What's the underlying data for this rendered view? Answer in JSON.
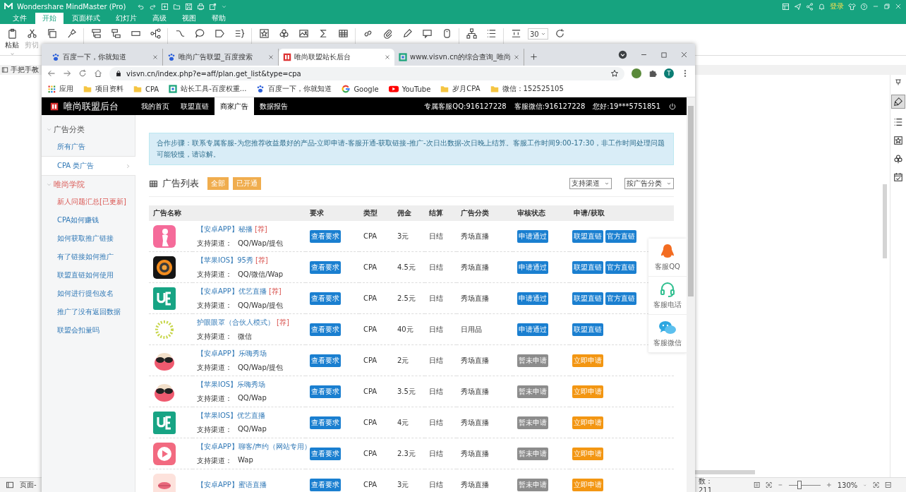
{
  "app": {
    "title": "Wondershare MindMaster (Pro)",
    "menu": [
      {
        "label": "文件",
        "selected": false
      },
      {
        "label": "开始",
        "selected": true
      },
      {
        "label": "页面样式",
        "selected": false
      },
      {
        "label": "幻灯片",
        "selected": false
      },
      {
        "label": "高级",
        "selected": false
      },
      {
        "label": "视图",
        "selected": false
      },
      {
        "label": "帮助",
        "selected": false
      }
    ],
    "login": "登录",
    "ribbon_labels": [
      {
        "label": "粘贴",
        "disabled": false
      },
      {
        "label": "剪切",
        "disabled": true
      }
    ],
    "font_size": "30",
    "document_tab": "手把手教",
    "status": {
      "page": "页面-",
      "count": "数：211",
      "zoom": "130%",
      "zoom_slider": {
        "level": 0.33
      }
    }
  },
  "browser": {
    "tabs": [
      {
        "title": "百度一下，你就知道",
        "kind": "paw",
        "selected": false
      },
      {
        "title": "唯尚广告联盟_百度搜索",
        "kind": "paw",
        "selected": false
      },
      {
        "title": "唯尚联盟站长后台",
        "kind": "logo",
        "selected": true
      },
      {
        "title": "www.visvn.cn的综合查询_唯尚",
        "kind": "square",
        "selected": false
      }
    ],
    "url": "visvn.cn/index.php?e=aff/plan.get_list&type=cpa",
    "profile": "T",
    "bookmarks": [
      {
        "label": "应用",
        "kind": "grid"
      },
      {
        "label": "项目资料",
        "kind": "folder"
      },
      {
        "label": "CPA",
        "kind": "folder"
      },
      {
        "label": "站长工具-百度权重...",
        "kind": "tool"
      },
      {
        "label": "百度一下，你就知道",
        "kind": "paw"
      },
      {
        "label": "Google",
        "kind": "google"
      },
      {
        "label": "YouTube",
        "kind": "youtube"
      },
      {
        "label": "岁月CPA",
        "kind": "folder"
      },
      {
        "label": "微信：152525105",
        "kind": "folder"
      }
    ]
  },
  "site": {
    "brand": "唯尚联盟后台",
    "nav": [
      {
        "label": "我的首页",
        "selected": false
      },
      {
        "label": "联盟直链",
        "selected": false
      },
      {
        "label": "商家广告",
        "selected": true
      },
      {
        "label": "数据报告",
        "selected": false
      }
    ],
    "contacts": [
      "专属客服QQ:916127228",
      "客服微信:916127228",
      "您好:19***5751851"
    ],
    "sidebar": [
      {
        "title": "广告分类",
        "highlighted": false,
        "expanded": true,
        "items": [
          {
            "label": "所有广告",
            "selected": false,
            "highlighted": false
          },
          {
            "label": "CPA 类广告",
            "selected": true,
            "highlighted": false
          }
        ]
      },
      {
        "title": "唯尚学院",
        "highlighted": true,
        "expanded": true,
        "items": [
          {
            "label": "新人问题汇总[已更新]",
            "selected": false,
            "highlighted": true
          },
          {
            "label": "CPA如何赚钱",
            "selected": false,
            "highlighted": false
          },
          {
            "label": "如何获取推广链接",
            "selected": false,
            "highlighted": false
          },
          {
            "label": "有了链接如何推广",
            "selected": false,
            "highlighted": false
          },
          {
            "label": "联盟直链如何使用",
            "selected": false,
            "highlighted": false
          },
          {
            "label": "如何进行提包改名",
            "selected": false,
            "highlighted": false
          },
          {
            "label": "推广了没有返回数据",
            "selected": false,
            "highlighted": false
          },
          {
            "label": "联盟会扣量吗",
            "selected": false,
            "highlighted": false
          }
        ]
      }
    ],
    "notice": "合作步骤：联系专属客服-为您推荐收益最好的产品-立即申请-客服开通-获取链接-推广-次日出数据-次日晚上结算。客服工作时间9:00-17:30，非工作时间处理问题可能较慢，请谅解。",
    "list": {
      "title": "广告列表",
      "filters": [
        "全部",
        "已开通"
      ],
      "selects": [
        "支持渠道",
        "按广告分类"
      ],
      "columns": [
        "广告名称",
        "要求",
        "类型",
        "佣金",
        "结算",
        "广告分类",
        "审核状态",
        "申请/获取"
      ],
      "rows": [
        {
          "kind": "pink-figure",
          "name": "【安卓APP】秘播",
          "tag": "[荐]",
          "channel_label": "支持渠道：",
          "channels": "QQ/Wap/提包",
          "require": "查看要求",
          "type": "CPA",
          "commission": "3元",
          "settle": "日结",
          "category": "秀场直播",
          "status": {
            "kind": "approved",
            "label": "申请通过"
          },
          "actions": [
            {
              "kind": "link",
              "label": "联盟直链"
            },
            {
              "kind": "link",
              "label": "官方直链"
            }
          ]
        },
        {
          "kind": "orange-ring",
          "name": "【苹果IOS】95秀",
          "tag": "[荐]",
          "channel_label": "支持渠道：",
          "channels": "QQ/微信/Wap",
          "require": "查看要求",
          "type": "CPA",
          "commission": "4.5元",
          "settle": "日结",
          "category": "秀场直播",
          "status": {
            "kind": "approved",
            "label": "申请通过"
          },
          "actions": [
            {
              "kind": "link",
              "label": "联盟直链"
            },
            {
              "kind": "link",
              "label": "官方直链"
            }
          ]
        },
        {
          "kind": "green-tile",
          "name": "【安卓APP】优艺直播",
          "tag": "[荐]",
          "channel_label": "支持渠道：",
          "channels": "QQ/Wap/提包",
          "require": "查看要求",
          "type": "CPA",
          "commission": "2.5元",
          "settle": "日结",
          "category": "秀场直播",
          "status": {
            "kind": "approved",
            "label": "申请通过"
          },
          "actions": [
            {
              "kind": "link",
              "label": "联盟直链"
            },
            {
              "kind": "link",
              "label": "官方直链"
            }
          ]
        },
        {
          "kind": "sun-ring",
          "name": "护眼眼罩（合伙人模式）",
          "tag": "[荐]",
          "channel_label": "支持渠道：",
          "channels": "微信",
          "require": "查看要求",
          "type": "CPA",
          "commission": "40元",
          "settle": "日结",
          "category": "日用品",
          "status": {
            "kind": "approved",
            "label": "申请通过"
          },
          "actions": [
            {
              "kind": "link",
              "label": "联盟直链"
            }
          ]
        },
        {
          "kind": "pink-mask",
          "name": "【安卓APP】乐嗨秀场",
          "channel_label": "支持渠道：",
          "channels": "QQ/Wap/提包",
          "require": "查看要求",
          "type": "CPA",
          "commission": "2元",
          "settle": "日结",
          "category": "秀场直播",
          "status": {
            "kind": "pending",
            "label": "暂未申请"
          },
          "actions": [
            {
              "kind": "apply",
              "label": "立即申请"
            }
          ]
        },
        {
          "kind": "pink-mask",
          "name": "【苹果IOS】乐嗨秀场",
          "channel_label": "支持渠道：",
          "channels": "QQ/Wap",
          "require": "查看要求",
          "type": "CPA",
          "commission": "3.5元",
          "settle": "日结",
          "category": "秀场直播",
          "status": {
            "kind": "pending",
            "label": "暂未申请"
          },
          "actions": [
            {
              "kind": "apply",
              "label": "立即申请"
            }
          ]
        },
        {
          "kind": "green-tile",
          "name": "【苹果IOS】优艺直播",
          "channel_label": "支持渠道：",
          "channels": "QQ/Wap",
          "require": "查看要求",
          "type": "CPA",
          "commission": "4元",
          "settle": "日结",
          "category": "秀场直播",
          "status": {
            "kind": "pending",
            "label": "暂未申请"
          },
          "actions": [
            {
              "kind": "apply",
              "label": "立即申请"
            }
          ]
        },
        {
          "kind": "pink-play",
          "name": "【安卓APP】聊客/声约（网站专用）",
          "channel_label": "支持渠道：",
          "channels": "Wap",
          "require": "查看要求",
          "type": "CPA",
          "commission": "2.3元",
          "settle": "日结",
          "category": "秀场直播",
          "status": {
            "kind": "pending",
            "label": "暂未申请"
          },
          "actions": [
            {
              "kind": "apply",
              "label": "立即申请"
            }
          ]
        },
        {
          "kind": "pink-lips",
          "name": "【安卓APP】蜜语直播",
          "require": "查看要求",
          "type": "CPA",
          "commission": "3元",
          "settle": "日结",
          "category": "秀场直播",
          "status": {
            "kind": "pending",
            "label": "暂未申请"
          },
          "actions": [
            {
              "kind": "apply",
              "label": "立即申请"
            }
          ]
        }
      ]
    },
    "support": [
      {
        "kind": "penguin",
        "label": "客服QQ"
      },
      {
        "kind": "headset",
        "label": "客服电话"
      },
      {
        "kind": "chat",
        "label": "客服微信"
      }
    ]
  }
}
